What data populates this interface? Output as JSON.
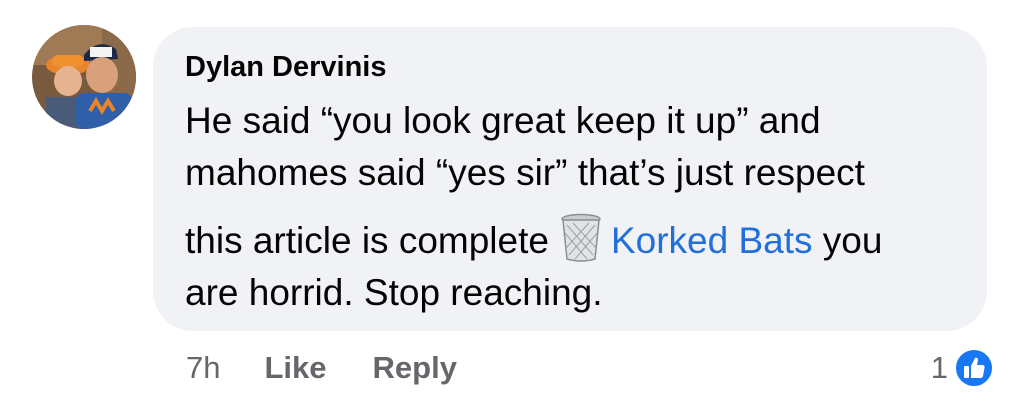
{
  "comment": {
    "author": "Dylan Dervinis",
    "lines": [
      "He said “you look great keep it up” and",
      "mahomes said “yes sir” that’s just respect"
    ],
    "line3_before": "this article is complete",
    "line3_emoji": "wastebasket-icon",
    "mention": "Korked Bats",
    "line3_after": " you",
    "line4": "are horrid. Stop reaching.",
    "timestamp": "7h",
    "like_label": "Like",
    "reply_label": "Reply",
    "reaction_count": "1",
    "reaction_icon": "like-icon"
  },
  "colors": {
    "bubble": "#f0f2f5",
    "text": "#050505",
    "secondary": "#65676b",
    "mention": "#216fdb",
    "like_blue": "#1877f2"
  }
}
